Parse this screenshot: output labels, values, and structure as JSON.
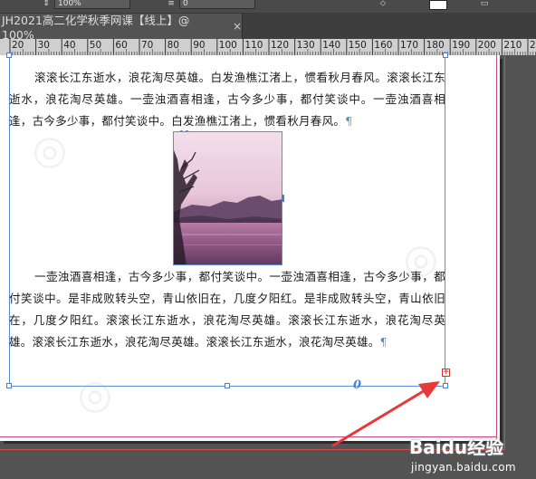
{
  "control_strip": {
    "zoom_value": "100%",
    "stroke_value": "0"
  },
  "document_tab": {
    "title": "JH2021高二化学秋季网课【线上】@ 100%",
    "close_symbol": "×"
  },
  "ruler": {
    "labels": [
      "20",
      "30",
      "40",
      "50",
      "60",
      "70",
      "80",
      "90",
      "100",
      "110",
      "120",
      "130",
      "140",
      "150",
      "160",
      "170",
      "180",
      "190",
      "200",
      "210",
      "220"
    ]
  },
  "text_frame": {
    "paragraph_1": "滚滚长江东逝水，浪花淘尽英雄。白发渔樵江渚上，惯看秋月春风。滚滚长江东逝水，浪花淘尽英雄。一壶浊酒喜相逢，古今多少事，都付笑谈中。一壶浊酒喜相逢，古今多少事，都付笑谈中。白发渔樵江渚上，惯看秋月春风。",
    "paragraph_2": "一壶浊酒喜相逢，古今多少事，都付笑谈中。一壶浊酒喜相逢，古今多少事，都付笑谈中。是非成败转头空，青山依旧在，几度夕阳红。是非成败转头空，青山依旧在，几度夕阳红。滚滚长江东逝水，浪花淘尽英雄。滚滚长江东逝水，浪花淘尽英雄。滚滚长江东逝水，浪花淘尽英雄。滚滚长江东逝水，浪花淘尽英雄。",
    "pilcrow": "¶",
    "overset_symbol": "0",
    "out_port_symbol": "+"
  },
  "image": {
    "description_icon": "lake-sunset-image"
  },
  "watermark": {
    "brand_logo": "Baidu经验",
    "brand_url": "jingyan.baidu.com"
  },
  "colors": {
    "frame_border": "#5b8ed8",
    "overset_red": "#d23030",
    "arrow_red": "#e8393a",
    "margin_guide": "#c24a8a"
  }
}
